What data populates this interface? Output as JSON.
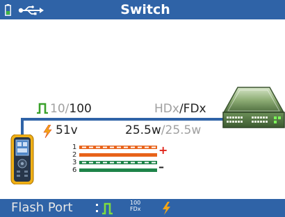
{
  "header": {
    "title": "Switch",
    "icons": [
      "battery-icon",
      "usb-icon"
    ]
  },
  "link": {
    "speed_inactive": "10",
    "speed_separator": "/",
    "speed_active": "100",
    "duplex_inactive": "HDx",
    "duplex_separator": "/",
    "duplex_active": "FDx"
  },
  "poe": {
    "voltage": "51v",
    "watts_active": "25.5w",
    "watts_separator": "/",
    "watts_inactive": "25.5w"
  },
  "pairs": {
    "numbers": [
      "1",
      "2",
      "3",
      "6"
    ],
    "positive_sign": "+",
    "negative_sign": "–",
    "colors": {
      "orange": "#e8631a",
      "green": "#1e8449"
    }
  },
  "status_bar": {
    "port_label": "Flash Port",
    "speed_small": "100",
    "duplex_small": "FDx"
  },
  "colors": {
    "accent_blue": "#2f63a7",
    "link_green": "#3aa12b",
    "poe_orange": "#f2a516"
  }
}
